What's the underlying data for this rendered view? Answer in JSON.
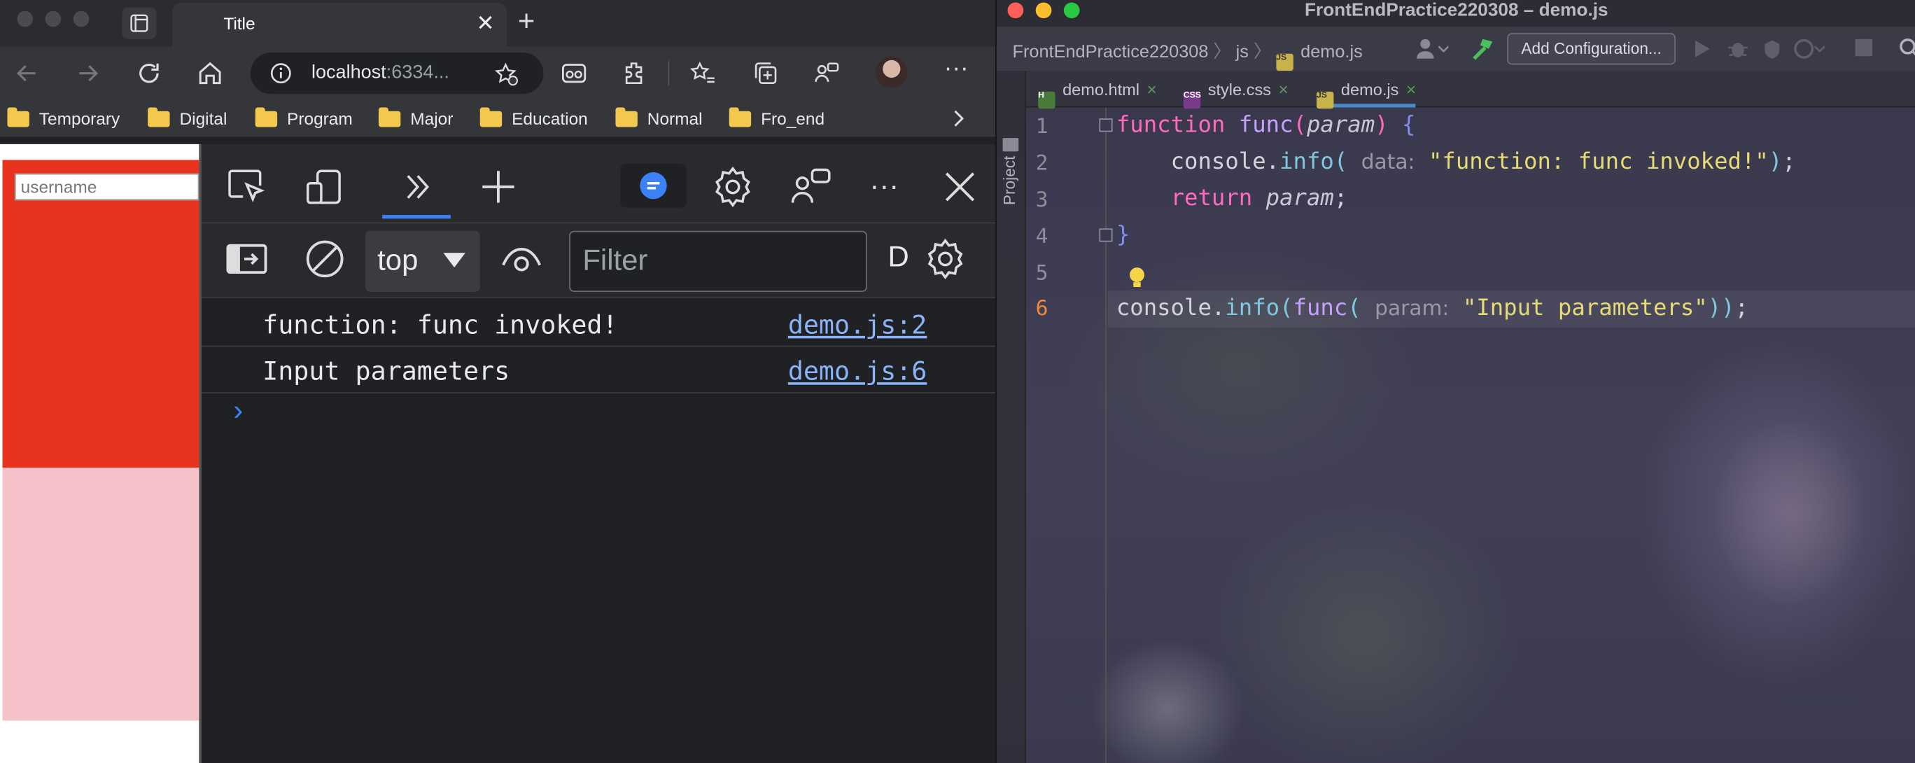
{
  "browser": {
    "tab": {
      "title": "Title"
    },
    "url": {
      "host": "localhost",
      "port": ":6334..."
    },
    "bookmarks": [
      "Temporary",
      "Digital",
      "Program",
      "Major",
      "Education",
      "Normal",
      "Fro_end"
    ],
    "page": {
      "username_placeholder": "username"
    },
    "devtools": {
      "context": "top",
      "filter_placeholder": "Filter",
      "truncated_label": "D",
      "logs": [
        {
          "message": "function: func invoked!",
          "source": "demo.js:2"
        },
        {
          "message": "Input parameters",
          "source": "demo.js:6"
        }
      ],
      "prompt": "›"
    }
  },
  "ide": {
    "window_title": "FrontEndPractice220308 – demo.js",
    "breadcrumbs": [
      "FrontEndPractice220308",
      "js",
      "demo.js"
    ],
    "add_config_label": "Add Configuration...",
    "project_label": "Project",
    "tabs": [
      {
        "name": "demo.html",
        "type": "html"
      },
      {
        "name": "style.css",
        "type": "css"
      },
      {
        "name": "demo.js",
        "type": "js",
        "active": true
      }
    ],
    "line_numbers": [
      "1",
      "2",
      "3",
      "4",
      "5",
      "6"
    ],
    "code": {
      "l1_kw": "function",
      "l1_fn": "func",
      "l1_param": "param",
      "l2_obj": "console",
      "l2_meth": "info",
      "l2_hint": "data:",
      "l2_str": "\"function: func invoked!\"",
      "l3_kw": "return",
      "l3_param": "param",
      "l6_obj": "console",
      "l6_meth": "info",
      "l6_fn": "func",
      "l6_hint": "param:",
      "l6_str": "\"Input parameters\""
    }
  },
  "colors": {
    "accent": "#3b82f6",
    "link": "#8ab4f8",
    "keyword": "#ff6ac1",
    "string": "#e6db74",
    "function": "#c6a0ff"
  }
}
